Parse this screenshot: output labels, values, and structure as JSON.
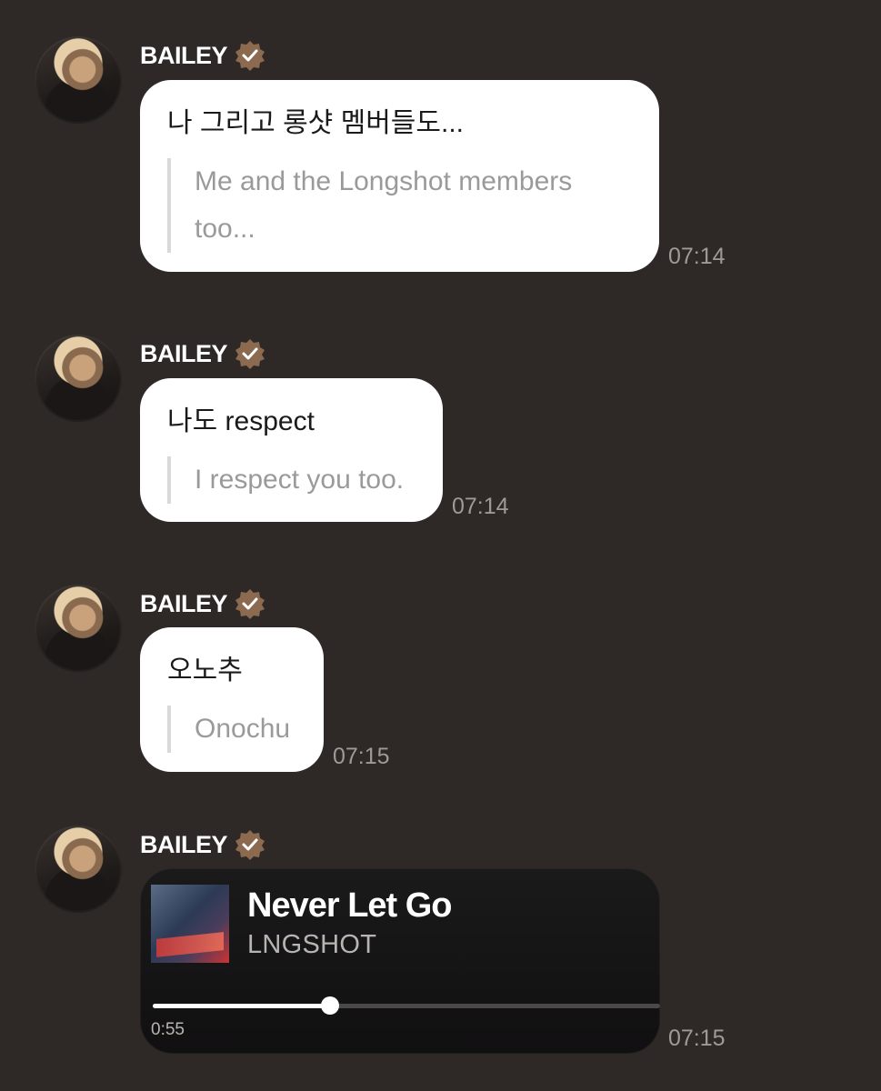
{
  "messages": [
    {
      "sender": "BAILEY",
      "text": "나 그리고 롱샷 멤버들도...",
      "translation": "Me and the Longshot members too...",
      "time": "07:14"
    },
    {
      "sender": "BAILEY",
      "text": "나도 respect",
      "translation": "I respect you too.",
      "time": "07:14"
    },
    {
      "sender": "BAILEY",
      "text": "오노추",
      "translation": "Onochu",
      "time": "07:15"
    },
    {
      "sender": "BAILEY",
      "music": {
        "title": "Never Let Go",
        "artist": "LNGSHOT",
        "elapsed": "0:55",
        "progress_fraction": 0.35
      },
      "time": "07:15"
    }
  ],
  "colors": {
    "background": "#2e2926",
    "bubble": "#ffffff",
    "verified_badge": "#8b6a4f"
  },
  "icons": {
    "verified": "verified-check-icon",
    "avatar": "profile-avatar"
  }
}
